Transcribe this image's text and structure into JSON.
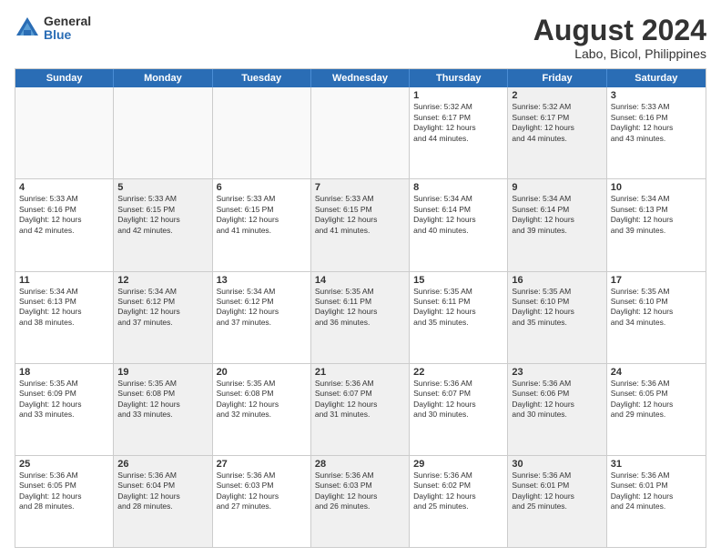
{
  "header": {
    "logo_general": "General",
    "logo_blue": "Blue",
    "title": "August 2024",
    "subtitle": "Labo, Bicol, Philippines"
  },
  "weekdays": [
    "Sunday",
    "Monday",
    "Tuesday",
    "Wednesday",
    "Thursday",
    "Friday",
    "Saturday"
  ],
  "rows": [
    [
      {
        "day": "",
        "info": "",
        "shaded": false,
        "empty": true
      },
      {
        "day": "",
        "info": "",
        "shaded": false,
        "empty": true
      },
      {
        "day": "",
        "info": "",
        "shaded": false,
        "empty": true
      },
      {
        "day": "",
        "info": "",
        "shaded": false,
        "empty": true
      },
      {
        "day": "1",
        "info": "Sunrise: 5:32 AM\nSunset: 6:17 PM\nDaylight: 12 hours\nand 44 minutes.",
        "shaded": false,
        "empty": false
      },
      {
        "day": "2",
        "info": "Sunrise: 5:32 AM\nSunset: 6:17 PM\nDaylight: 12 hours\nand 44 minutes.",
        "shaded": true,
        "empty": false
      },
      {
        "day": "3",
        "info": "Sunrise: 5:33 AM\nSunset: 6:16 PM\nDaylight: 12 hours\nand 43 minutes.",
        "shaded": false,
        "empty": false
      }
    ],
    [
      {
        "day": "4",
        "info": "Sunrise: 5:33 AM\nSunset: 6:16 PM\nDaylight: 12 hours\nand 42 minutes.",
        "shaded": false,
        "empty": false
      },
      {
        "day": "5",
        "info": "Sunrise: 5:33 AM\nSunset: 6:15 PM\nDaylight: 12 hours\nand 42 minutes.",
        "shaded": true,
        "empty": false
      },
      {
        "day": "6",
        "info": "Sunrise: 5:33 AM\nSunset: 6:15 PM\nDaylight: 12 hours\nand 41 minutes.",
        "shaded": false,
        "empty": false
      },
      {
        "day": "7",
        "info": "Sunrise: 5:33 AM\nSunset: 6:15 PM\nDaylight: 12 hours\nand 41 minutes.",
        "shaded": true,
        "empty": false
      },
      {
        "day": "8",
        "info": "Sunrise: 5:34 AM\nSunset: 6:14 PM\nDaylight: 12 hours\nand 40 minutes.",
        "shaded": false,
        "empty": false
      },
      {
        "day": "9",
        "info": "Sunrise: 5:34 AM\nSunset: 6:14 PM\nDaylight: 12 hours\nand 39 minutes.",
        "shaded": true,
        "empty": false
      },
      {
        "day": "10",
        "info": "Sunrise: 5:34 AM\nSunset: 6:13 PM\nDaylight: 12 hours\nand 39 minutes.",
        "shaded": false,
        "empty": false
      }
    ],
    [
      {
        "day": "11",
        "info": "Sunrise: 5:34 AM\nSunset: 6:13 PM\nDaylight: 12 hours\nand 38 minutes.",
        "shaded": false,
        "empty": false
      },
      {
        "day": "12",
        "info": "Sunrise: 5:34 AM\nSunset: 6:12 PM\nDaylight: 12 hours\nand 37 minutes.",
        "shaded": true,
        "empty": false
      },
      {
        "day": "13",
        "info": "Sunrise: 5:34 AM\nSunset: 6:12 PM\nDaylight: 12 hours\nand 37 minutes.",
        "shaded": false,
        "empty": false
      },
      {
        "day": "14",
        "info": "Sunrise: 5:35 AM\nSunset: 6:11 PM\nDaylight: 12 hours\nand 36 minutes.",
        "shaded": true,
        "empty": false
      },
      {
        "day": "15",
        "info": "Sunrise: 5:35 AM\nSunset: 6:11 PM\nDaylight: 12 hours\nand 35 minutes.",
        "shaded": false,
        "empty": false
      },
      {
        "day": "16",
        "info": "Sunrise: 5:35 AM\nSunset: 6:10 PM\nDaylight: 12 hours\nand 35 minutes.",
        "shaded": true,
        "empty": false
      },
      {
        "day": "17",
        "info": "Sunrise: 5:35 AM\nSunset: 6:10 PM\nDaylight: 12 hours\nand 34 minutes.",
        "shaded": false,
        "empty": false
      }
    ],
    [
      {
        "day": "18",
        "info": "Sunrise: 5:35 AM\nSunset: 6:09 PM\nDaylight: 12 hours\nand 33 minutes.",
        "shaded": false,
        "empty": false
      },
      {
        "day": "19",
        "info": "Sunrise: 5:35 AM\nSunset: 6:08 PM\nDaylight: 12 hours\nand 33 minutes.",
        "shaded": true,
        "empty": false
      },
      {
        "day": "20",
        "info": "Sunrise: 5:35 AM\nSunset: 6:08 PM\nDaylight: 12 hours\nand 32 minutes.",
        "shaded": false,
        "empty": false
      },
      {
        "day": "21",
        "info": "Sunrise: 5:36 AM\nSunset: 6:07 PM\nDaylight: 12 hours\nand 31 minutes.",
        "shaded": true,
        "empty": false
      },
      {
        "day": "22",
        "info": "Sunrise: 5:36 AM\nSunset: 6:07 PM\nDaylight: 12 hours\nand 30 minutes.",
        "shaded": false,
        "empty": false
      },
      {
        "day": "23",
        "info": "Sunrise: 5:36 AM\nSunset: 6:06 PM\nDaylight: 12 hours\nand 30 minutes.",
        "shaded": true,
        "empty": false
      },
      {
        "day": "24",
        "info": "Sunrise: 5:36 AM\nSunset: 6:05 PM\nDaylight: 12 hours\nand 29 minutes.",
        "shaded": false,
        "empty": false
      }
    ],
    [
      {
        "day": "25",
        "info": "Sunrise: 5:36 AM\nSunset: 6:05 PM\nDaylight: 12 hours\nand 28 minutes.",
        "shaded": false,
        "empty": false
      },
      {
        "day": "26",
        "info": "Sunrise: 5:36 AM\nSunset: 6:04 PM\nDaylight: 12 hours\nand 28 minutes.",
        "shaded": true,
        "empty": false
      },
      {
        "day": "27",
        "info": "Sunrise: 5:36 AM\nSunset: 6:03 PM\nDaylight: 12 hours\nand 27 minutes.",
        "shaded": false,
        "empty": false
      },
      {
        "day": "28",
        "info": "Sunrise: 5:36 AM\nSunset: 6:03 PM\nDaylight: 12 hours\nand 26 minutes.",
        "shaded": true,
        "empty": false
      },
      {
        "day": "29",
        "info": "Sunrise: 5:36 AM\nSunset: 6:02 PM\nDaylight: 12 hours\nand 25 minutes.",
        "shaded": false,
        "empty": false
      },
      {
        "day": "30",
        "info": "Sunrise: 5:36 AM\nSunset: 6:01 PM\nDaylight: 12 hours\nand 25 minutes.",
        "shaded": true,
        "empty": false
      },
      {
        "day": "31",
        "info": "Sunrise: 5:36 AM\nSunset: 6:01 PM\nDaylight: 12 hours\nand 24 minutes.",
        "shaded": false,
        "empty": false
      }
    ]
  ]
}
